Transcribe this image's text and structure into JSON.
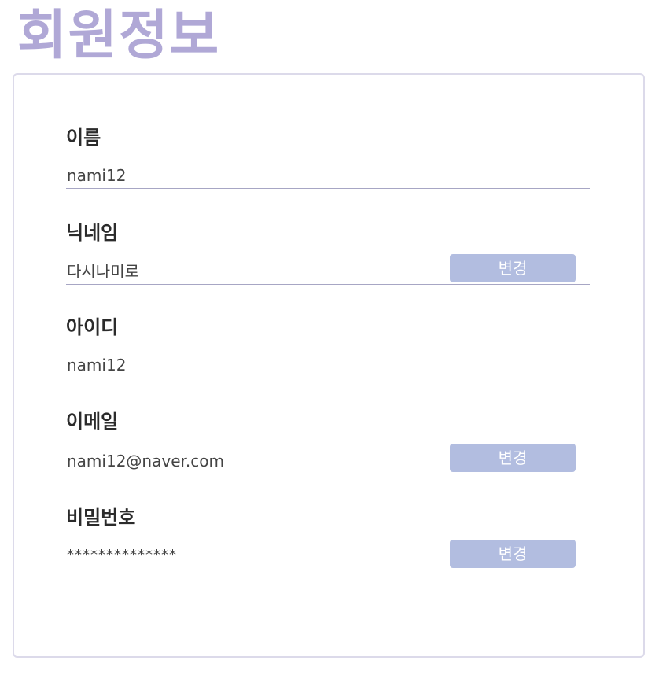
{
  "page": {
    "title": "회원정보"
  },
  "fields": {
    "name": {
      "label": "이름",
      "value": "nami12"
    },
    "nickname": {
      "label": "닉네임",
      "value": "다시나미로",
      "button": "변경"
    },
    "user_id": {
      "label": "아이디",
      "value": "nami12"
    },
    "email": {
      "label": "이메일",
      "value": "nami12@naver.com",
      "button": "변경"
    },
    "password": {
      "label": "비밀번호",
      "value": "**************",
      "button": "변경"
    }
  },
  "colors": {
    "title": "#b0a8d6",
    "button_bg": "#b2bde0",
    "underline": "#a7a6c4",
    "card_border": "#dcdaea"
  }
}
